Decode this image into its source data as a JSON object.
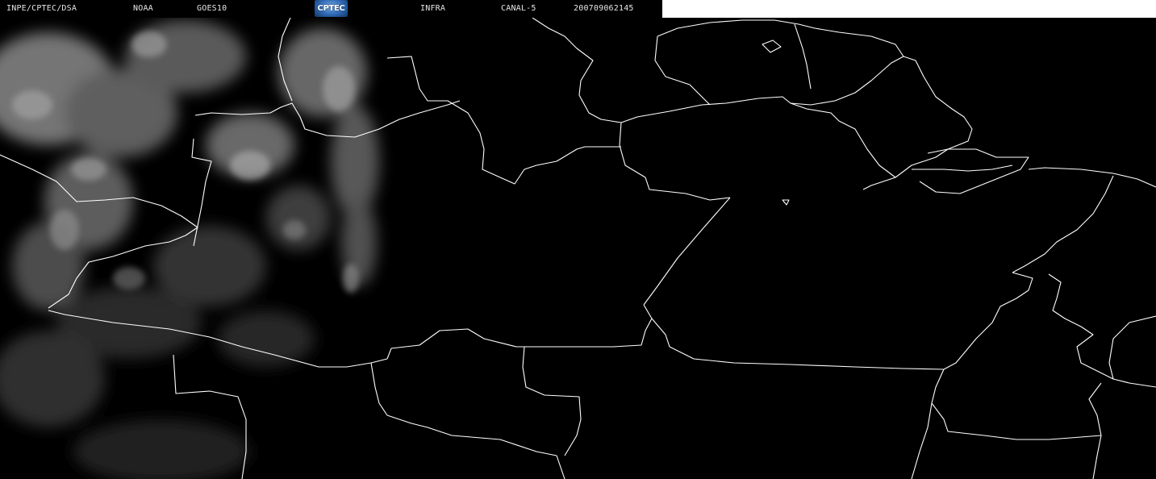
{
  "header": {
    "agency": "INPE/CPTEC/DSA",
    "operator": "NOAA",
    "satellite": "GOES10",
    "logo_text": "CPTEC",
    "product": "INFRA",
    "channel": "CANAL-5",
    "timestamp": "200709062145"
  },
  "colors": {
    "background": "#000000",
    "coastline": "#ffffff",
    "header_text": "#e6e6e6",
    "cloud_gray": "#8a8a8a",
    "logo_blue": "#2c67b3"
  }
}
